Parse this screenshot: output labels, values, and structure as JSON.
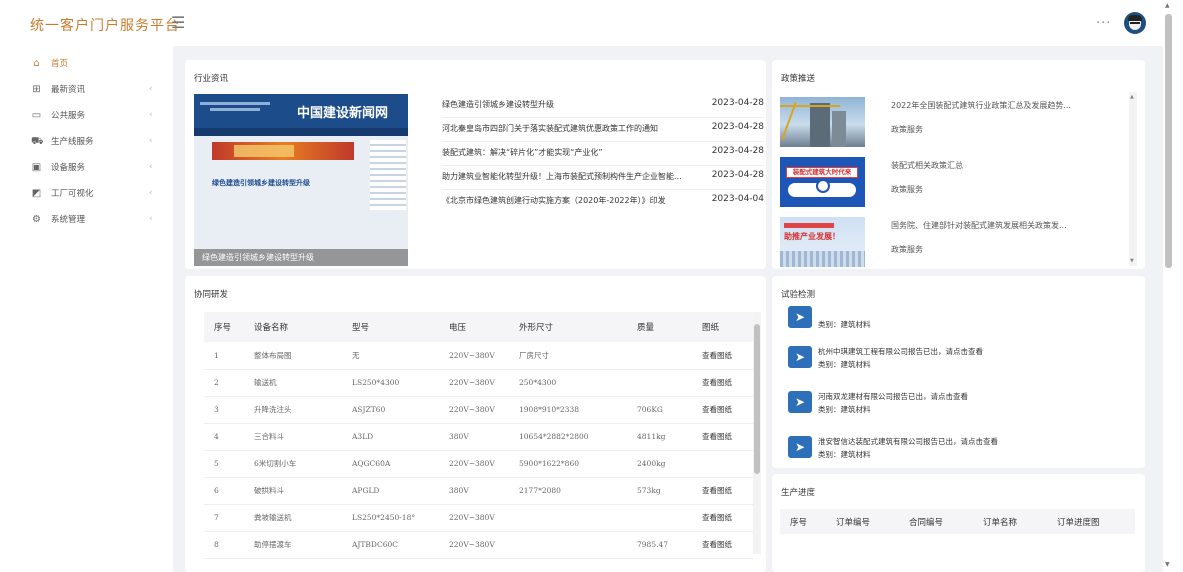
{
  "app": {
    "title": "统一客户门户服务平台"
  },
  "colors": {
    "accent": "#c87c2d",
    "brand_blue": "#2d6fb8"
  },
  "sidebar": {
    "items": [
      {
        "label": "首页",
        "icon": "home-icon",
        "active": true
      },
      {
        "label": "最新资讯",
        "icon": "news-icon"
      },
      {
        "label": "公共服务",
        "icon": "monitor-icon"
      },
      {
        "label": "生产线服务",
        "icon": "cart-icon"
      },
      {
        "label": "设备服务",
        "icon": "device-icon"
      },
      {
        "label": "工厂可视化",
        "icon": "chart-icon"
      },
      {
        "label": "系统管理",
        "icon": "gear-icon"
      }
    ]
  },
  "industry": {
    "title": "行业资讯",
    "image": {
      "site_name": "中国建设新闻网",
      "headline": "绿色建造引领城乡建设转型升级",
      "caption": "绿色建造引领城乡建设转型升级"
    },
    "news": [
      {
        "title": "绿色建造引领城乡建设转型升级",
        "date": "2023-04-28"
      },
      {
        "title": "河北秦皇岛市四部门关于落实装配式建筑优惠政策工作的通知",
        "date": "2023-04-28"
      },
      {
        "title": "装配式建筑：解决“碎片化”才能实现“产业化”",
        "date": "2023-04-28"
      },
      {
        "title": "助力建筑业智能化转型升级！上海市装配式预制构件生产企业智能...",
        "date": "2023-04-28"
      },
      {
        "title": "《北京市绿色建筑创建行动实施方案（2020年-2022年）》印发",
        "date": "2023-04-04"
      }
    ]
  },
  "policy": {
    "title": "政策推送",
    "items": [
      {
        "title": "2022年全国装配式建筑行业政策汇总及发展趋势...",
        "tag": "政策服务"
      },
      {
        "title": "装配式相关政策汇总",
        "tag": "政策服务",
        "thumb_text": "装配式建筑大时代来"
      },
      {
        "title": "国务院、住建部针对装配式建筑发展相关政策发...",
        "tag": "政策服务",
        "thumb_text": "助推产业发展！"
      }
    ]
  },
  "collab": {
    "title": "协同研发",
    "columns": [
      "序号",
      "设备名称",
      "型号",
      "电压",
      "外形尺寸",
      "质量",
      "图纸"
    ],
    "rows": [
      [
        "1",
        "整体布局图",
        "无",
        "220V~380V",
        "厂房尺寸",
        "",
        "查看图纸"
      ],
      [
        "2",
        "输送机",
        "LS250*4300",
        "220V~380V",
        "250*4300",
        "",
        "查看图纸"
      ],
      [
        "3",
        "升降洗注头",
        "ASJZT60",
        "220V~380V",
        "1908*910*2338",
        "706KG",
        "查看图纸"
      ],
      [
        "4",
        "三合料斗",
        "A3LD",
        "380V",
        "10654*2882*2800",
        "4811kg",
        "查看图纸"
      ],
      [
        "5",
        "6米切割小车",
        "AQGC60A",
        "220V~380V",
        "5900*1622*860",
        "2400kg",
        ""
      ],
      [
        "6",
        "破拱料斗",
        "APGLD",
        "380V",
        "2177*2080",
        "573kg",
        "查看图纸"
      ],
      [
        "7",
        "粪坡输送机",
        "LS250*2450-18°",
        "220V~380V",
        "",
        "",
        "查看图纸"
      ],
      [
        "8",
        "助停摆渡车",
        "AJTBDC60C",
        "220V~380V",
        "",
        "7985.47",
        "查看图纸"
      ]
    ]
  },
  "test": {
    "title": "试验检测",
    "items": [
      {
        "msg": "",
        "cat": "类别：建筑材料"
      },
      {
        "msg": "杭州中琪建筑工程有限公司报告已出，请点击查看",
        "cat": "类别：建筑材料"
      },
      {
        "msg": "河南双龙建材有限公司报告已出，请点击查看",
        "cat": "类别：建筑材料"
      },
      {
        "msg": "淮安智信达装配式建筑有限公司报告已出，请点击查看",
        "cat": "类别：建筑材料"
      }
    ]
  },
  "production": {
    "title": "生产进度",
    "columns": [
      "序号",
      "订单编号",
      "合同编号",
      "订单名称",
      "订单进度图"
    ]
  }
}
